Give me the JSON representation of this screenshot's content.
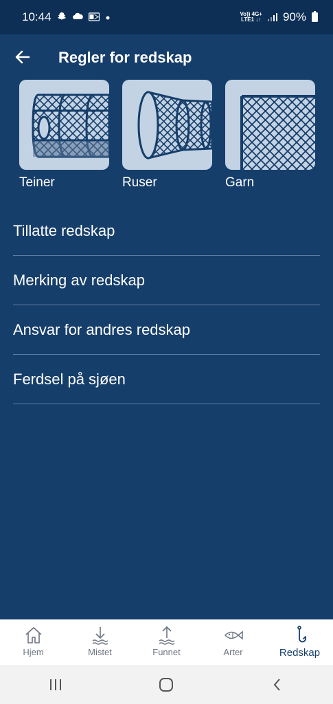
{
  "status_bar": {
    "time": "10:44",
    "network_top": "Vo)) 4G+",
    "network_bottom": "LTE1 ↓↑",
    "battery": "90%"
  },
  "header": {
    "title": "Regler for redskap"
  },
  "gear_types": [
    {
      "label": "Teiner",
      "icon": "crab-pot-icon"
    },
    {
      "label": "Ruser",
      "icon": "fyke-net-icon"
    },
    {
      "label": "Garn",
      "icon": "gillnet-icon"
    }
  ],
  "menu": [
    {
      "label": "Tillatte redskap"
    },
    {
      "label": "Merking av redskap"
    },
    {
      "label": "Ansvar for andres redskap"
    },
    {
      "label": "Ferdsel på sjøen"
    }
  ],
  "bottom_nav": [
    {
      "label": "Hjem",
      "icon": "home-icon",
      "active": false
    },
    {
      "label": "Mistet",
      "icon": "download-icon",
      "active": false
    },
    {
      "label": "Funnet",
      "icon": "upload-icon",
      "active": false
    },
    {
      "label": "Arter",
      "icon": "fish-icon",
      "active": false
    },
    {
      "label": "Redskap",
      "icon": "hook-icon",
      "active": true
    }
  ],
  "colors": {
    "background": "#163e6a",
    "status_bar": "#0e2f55",
    "card_bg": "#c3d3e4",
    "active_nav": "#163e6a"
  }
}
